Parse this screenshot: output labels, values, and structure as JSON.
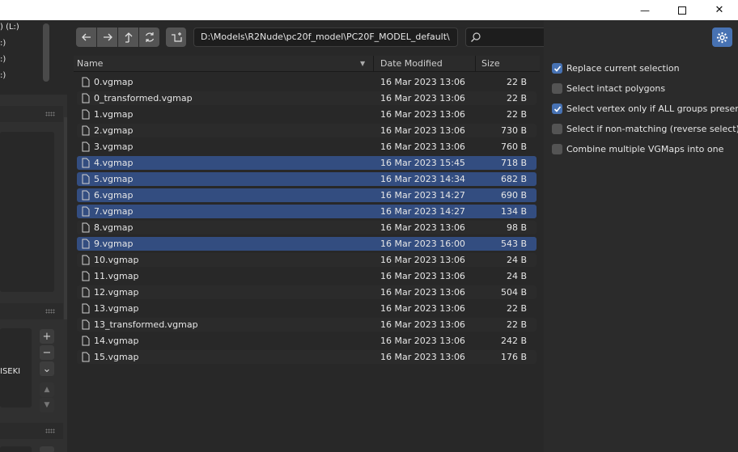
{
  "window": {
    "minimize_glyph": "—",
    "maximize_glyph": "☐",
    "close_glyph": "✕"
  },
  "left_panel": {
    "drive_items": [
      ") (L:)",
      ":)",
      ":)",
      ":)"
    ],
    "partial_label": "ISEKI",
    "add_glyph": "+",
    "remove_glyph": "−",
    "dropdown_glyph": "⌄",
    "up_glyph": "▲",
    "down_glyph": "▼"
  },
  "toolbar": {
    "path": "D:\\Models\\R2Nude\\pc20f_model\\PC20F_MODEL_default\\",
    "search_placeholder": "",
    "icons": [
      "back-icon",
      "forward-icon",
      "parent-directory-icon",
      "refresh-icon",
      "new-folder-icon",
      "search-icon",
      "vertical-list-icon",
      "horizontal-list-icon",
      "thumbnails-icon",
      "chevron-down-icon",
      "filter-icon",
      "chevron-down-icon",
      "settings-icon"
    ]
  },
  "columns": {
    "name": "Name",
    "date": "Date Modified",
    "size": "Size"
  },
  "files": [
    {
      "name": "0.vgmap",
      "date": "16 Mar 2023 13:06",
      "size": "22 B",
      "selected": false
    },
    {
      "name": "0_transformed.vgmap",
      "date": "16 Mar 2023 13:06",
      "size": "22 B",
      "selected": false
    },
    {
      "name": "1.vgmap",
      "date": "16 Mar 2023 13:06",
      "size": "22 B",
      "selected": false
    },
    {
      "name": "2.vgmap",
      "date": "16 Mar 2023 13:06",
      "size": "730 B",
      "selected": false
    },
    {
      "name": "3.vgmap",
      "date": "16 Mar 2023 13:06",
      "size": "760 B",
      "selected": false
    },
    {
      "name": "4.vgmap",
      "date": "16 Mar 2023 15:45",
      "size": "718 B",
      "selected": true
    },
    {
      "name": "5.vgmap",
      "date": "16 Mar 2023 14:34",
      "size": "682 B",
      "selected": true
    },
    {
      "name": "6.vgmap",
      "date": "16 Mar 2023 14:27",
      "size": "690 B",
      "selected": true
    },
    {
      "name": "7.vgmap",
      "date": "16 Mar 2023 14:27",
      "size": "134 B",
      "selected": true
    },
    {
      "name": "8.vgmap",
      "date": "16 Mar 2023 13:06",
      "size": "98 B",
      "selected": false
    },
    {
      "name": "9.vgmap",
      "date": "16 Mar 2023 16:00",
      "size": "543 B",
      "selected": true
    },
    {
      "name": "10.vgmap",
      "date": "16 Mar 2023 13:06",
      "size": "24 B",
      "selected": false
    },
    {
      "name": "11.vgmap",
      "date": "16 Mar 2023 13:06",
      "size": "24 B",
      "selected": false
    },
    {
      "name": "12.vgmap",
      "date": "16 Mar 2023 13:06",
      "size": "504 B",
      "selected": false
    },
    {
      "name": "13.vgmap",
      "date": "16 Mar 2023 13:06",
      "size": "22 B",
      "selected": false
    },
    {
      "name": "13_transformed.vgmap",
      "date": "16 Mar 2023 13:06",
      "size": "22 B",
      "selected": false
    },
    {
      "name": "14.vgmap",
      "date": "16 Mar 2023 13:06",
      "size": "242 B",
      "selected": false
    },
    {
      "name": "15.vgmap",
      "date": "16 Mar 2023 13:06",
      "size": "176 B",
      "selected": false
    }
  ],
  "options": [
    {
      "label": "Replace current selection",
      "checked": true
    },
    {
      "label": "Select intact polygons",
      "checked": false
    },
    {
      "label": "Select vertex only if ALL groups present",
      "checked": true
    },
    {
      "label": "Select if non-matching (reverse select)",
      "checked": false
    },
    {
      "label": "Combine multiple VGMaps into one",
      "checked": false
    }
  ],
  "colors": {
    "accent": "#4772b3",
    "selection": "#334d80"
  }
}
